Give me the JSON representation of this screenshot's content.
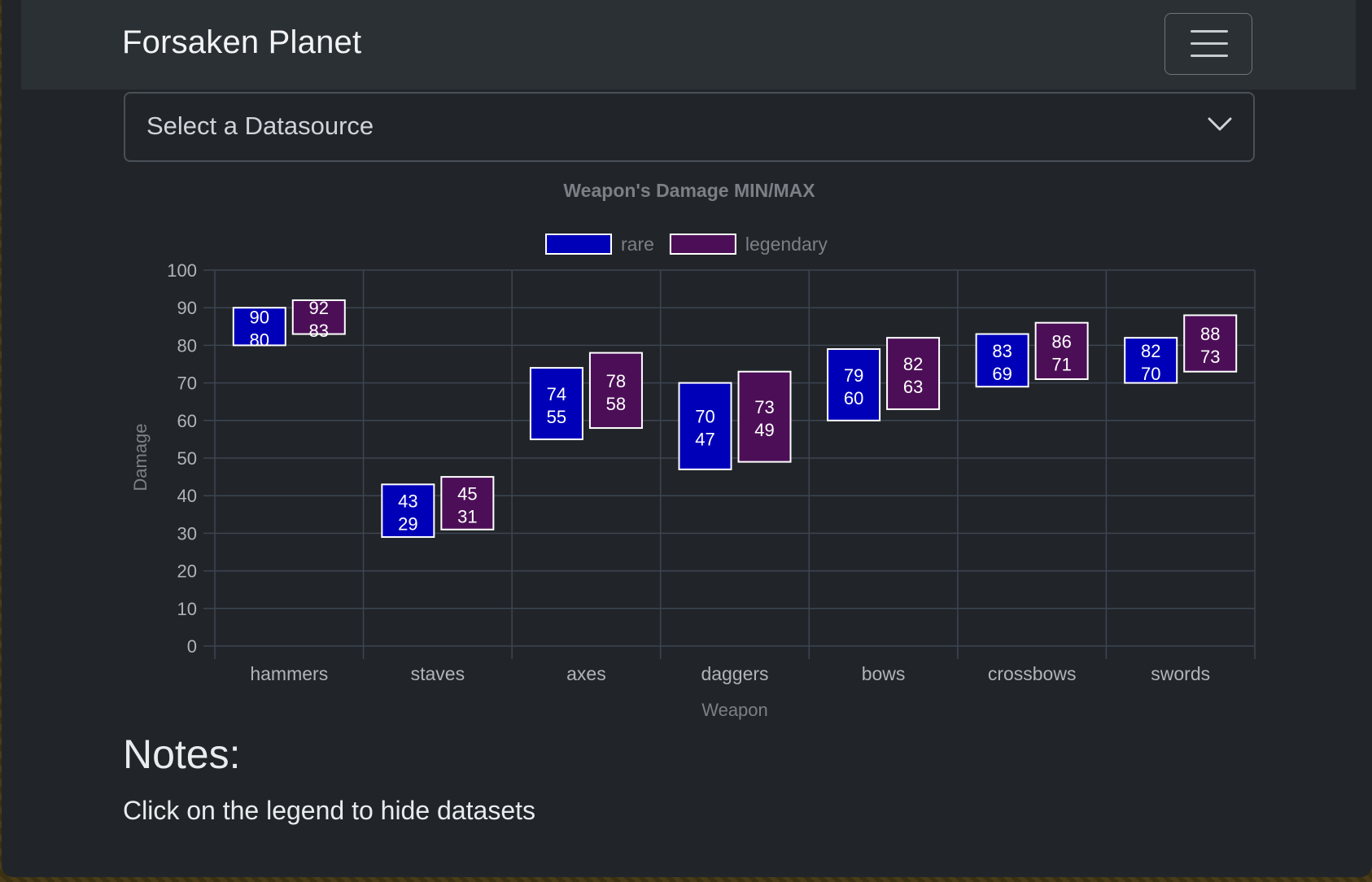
{
  "navbar": {
    "brand": "Forsaken Planet",
    "menu_icon": "hamburger-menu-icon"
  },
  "datasource_select": {
    "value": "Select a Datasource",
    "icon": "chevron-down-icon"
  },
  "colors": {
    "rare_fill": "#0000b8",
    "legendary_fill": "#4c0f57",
    "bar_border": "#ffffff",
    "grid": "#3d4553",
    "text_muted": "#7c8086",
    "tick_text": "#b0b4ba"
  },
  "chart_data": {
    "type": "bar",
    "subtype": "floating-range",
    "title": "Weapon's Damage MIN/MAX",
    "xlabel": "Weapon",
    "ylabel": "Damage",
    "ylim": [
      0,
      100
    ],
    "yticks": [
      0,
      10,
      20,
      30,
      40,
      50,
      60,
      70,
      80,
      90,
      100
    ],
    "grid": true,
    "legend_position": "top",
    "categories": [
      "hammers",
      "staves",
      "axes",
      "daggers",
      "bows",
      "crossbows",
      "swords"
    ],
    "series": [
      {
        "name": "rare",
        "min": [
          80,
          29,
          55,
          47,
          60,
          69,
          70
        ],
        "max": [
          90,
          43,
          74,
          70,
          79,
          83,
          82
        ]
      },
      {
        "name": "legendary",
        "min": [
          83,
          31,
          58,
          49,
          63,
          71,
          73
        ],
        "max": [
          92,
          45,
          78,
          73,
          82,
          86,
          88
        ]
      }
    ]
  },
  "notes": {
    "title": "Notes:",
    "text": "Click on the legend to hide datasets"
  }
}
